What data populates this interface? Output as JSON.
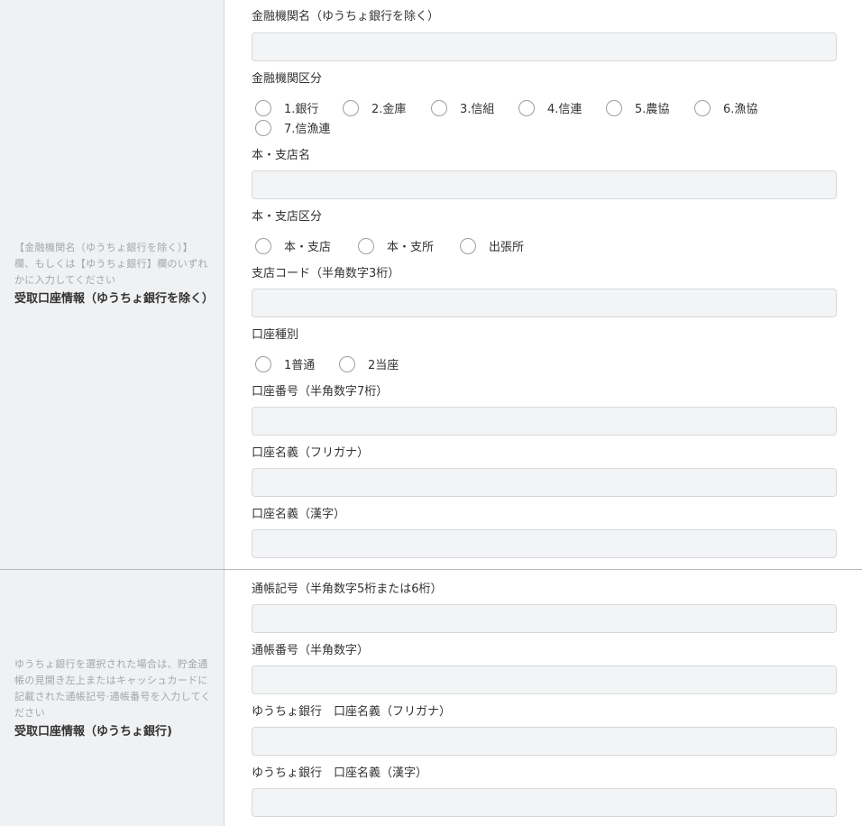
{
  "bank_section": {
    "note": "【金融機関名（ゆうちょ銀行を除く）】欄、もしくは【ゆうちょ銀行】欄のいずれかに入力してください",
    "heading": "受取口座情報（ゆうちょ銀行を除く）",
    "fields": {
      "institution_name": {
        "label": "金融機関名（ゆうちょ銀行を除く）",
        "value": "",
        "placeholder": ""
      },
      "institution_type": {
        "label": "金融機関区分",
        "options": [
          "1.銀行",
          "2.金庫",
          "3.信組",
          "4.信連",
          "5.農協",
          "6.漁協",
          "7.信漁連"
        ]
      },
      "branch_name": {
        "label": "本・支店名",
        "value": "",
        "placeholder": ""
      },
      "branch_type": {
        "label": "本・支店区分",
        "options": [
          "本・支店",
          "本・支所",
          "出張所"
        ]
      },
      "branch_code": {
        "label": "支店コード（半角数字3桁）",
        "value": "",
        "placeholder": ""
      },
      "account_type": {
        "label": "口座種別",
        "options": [
          "1普通",
          "2当座"
        ]
      },
      "account_number": {
        "label": "口座番号（半角数字7桁）",
        "value": "",
        "placeholder": ""
      },
      "holder_kana": {
        "label": "口座名義（フリガナ）",
        "value": "",
        "placeholder": ""
      },
      "holder_kanji": {
        "label": "口座名義（漢字）",
        "value": "",
        "placeholder": ""
      }
    }
  },
  "yucho_section": {
    "note": "ゆうちょ銀行を選択された場合は、貯金通帳の見開き左上またはキャッシュカードに記載された通帳記号·通帳番号を入力してください",
    "heading": "受取口座情報（ゆうちょ銀行)",
    "fields": {
      "passbook_symbol": {
        "label": "通帳記号（半角数字5桁または6桁）",
        "value": "",
        "placeholder": ""
      },
      "passbook_number": {
        "label": "通帳番号（半角数字）",
        "value": "",
        "placeholder": ""
      },
      "holder_kana": {
        "label": "ゆうちょ銀行　口座名義（フリガナ）",
        "value": "",
        "placeholder": ""
      },
      "holder_kanji": {
        "label": "ゆうちょ銀行　口座名義（漢字）",
        "value": "",
        "placeholder": ""
      }
    }
  }
}
